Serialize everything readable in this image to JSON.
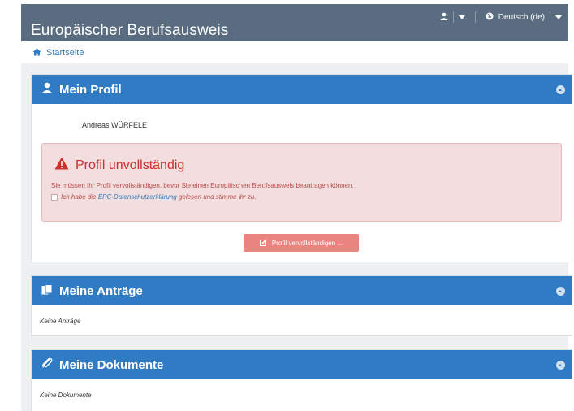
{
  "header": {
    "brand": "Europäischer Berufsausweis",
    "language": "Deutsch (de)"
  },
  "breadcrumb": {
    "home_label": "Startseite"
  },
  "profile": {
    "title": "Mein Profil",
    "user_name": "Andreas WÜRFELE",
    "alert": {
      "title": "Profil unvollständig",
      "message": "Sie müssen Ihr Profil vervollständigen, bevor Sie einen Europäischen Berufsausweis beantragen können.",
      "consent_prefix": "Ich habe die ",
      "consent_link": "EPC-Datenschutzerklärung",
      "consent_suffix": " gelesen und stimme ihr zu."
    },
    "complete_button": "Profil vervollständigen ..."
  },
  "applications": {
    "title": "Meine Anträge",
    "empty": "Keine Anträge"
  },
  "documents": {
    "title": "Meine Dokumente",
    "empty": "Keine Dokumente"
  },
  "colors": {
    "navbar": "#5a6d80",
    "panel_header": "#2f7cc4",
    "alert_bg": "#f2dede",
    "alert_text": "#c9302c",
    "button_danger": "#e98480",
    "link": "#337ab7"
  }
}
